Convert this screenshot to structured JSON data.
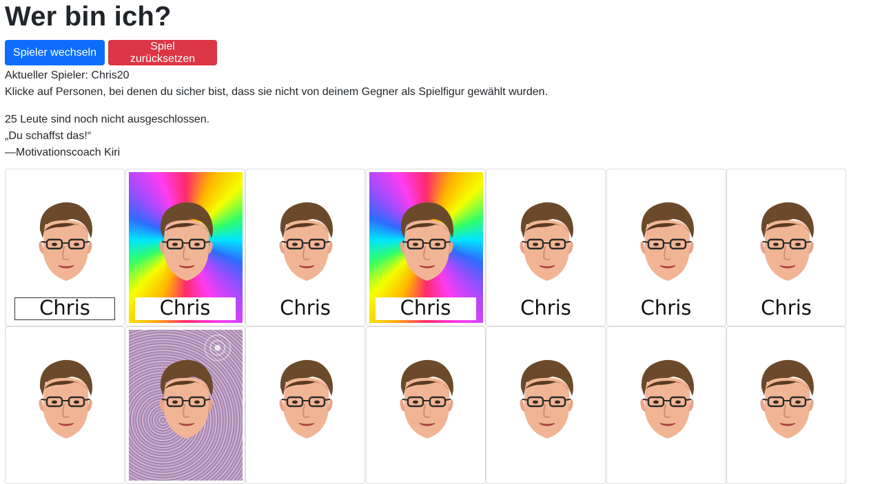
{
  "page": {
    "title": "Wer bin ich?",
    "buttons": {
      "switch_player": "Spieler wechseln",
      "reset_game": "Spiel zurücksetzen"
    },
    "current_player_label": "Aktueller Spieler: Chris20",
    "instruction": "Klicke auf Personen, bei denen du sicher bist, dass sie nicht von deinem Gegner als Spielfigur gewählt wurden.",
    "remaining": "25 Leute sind noch nicht ausgeschlossen.",
    "quote": "„Du schaffst das!“",
    "quote_author": "—Motivationscoach Kiri"
  },
  "colors": {
    "primary": "#0d6efd",
    "danger": "#dc3545",
    "text": "#212529"
  },
  "cards": [
    {
      "name": "Chris",
      "background": "plain",
      "label_style": "framed"
    },
    {
      "name": "Chris",
      "background": "rainbow",
      "label_style": "white"
    },
    {
      "name": "Chris",
      "background": "plain",
      "label_style": "none"
    },
    {
      "name": "Chris",
      "background": "rainbow",
      "label_style": "white"
    },
    {
      "name": "Chris",
      "background": "plain",
      "label_style": "none"
    },
    {
      "name": "Chris",
      "background": "plain",
      "label_style": "none"
    },
    {
      "name": "Chris",
      "background": "plain",
      "label_style": "none"
    },
    {
      "name": "",
      "background": "plain",
      "label_style": "none"
    },
    {
      "name": "",
      "background": "glitter",
      "label_style": "none"
    },
    {
      "name": "",
      "background": "plain",
      "label_style": "none"
    },
    {
      "name": "",
      "background": "plain",
      "label_style": "none"
    },
    {
      "name": "",
      "background": "plain",
      "label_style": "none"
    },
    {
      "name": "",
      "background": "plain",
      "label_style": "none"
    },
    {
      "name": "",
      "background": "plain",
      "label_style": "none"
    }
  ]
}
